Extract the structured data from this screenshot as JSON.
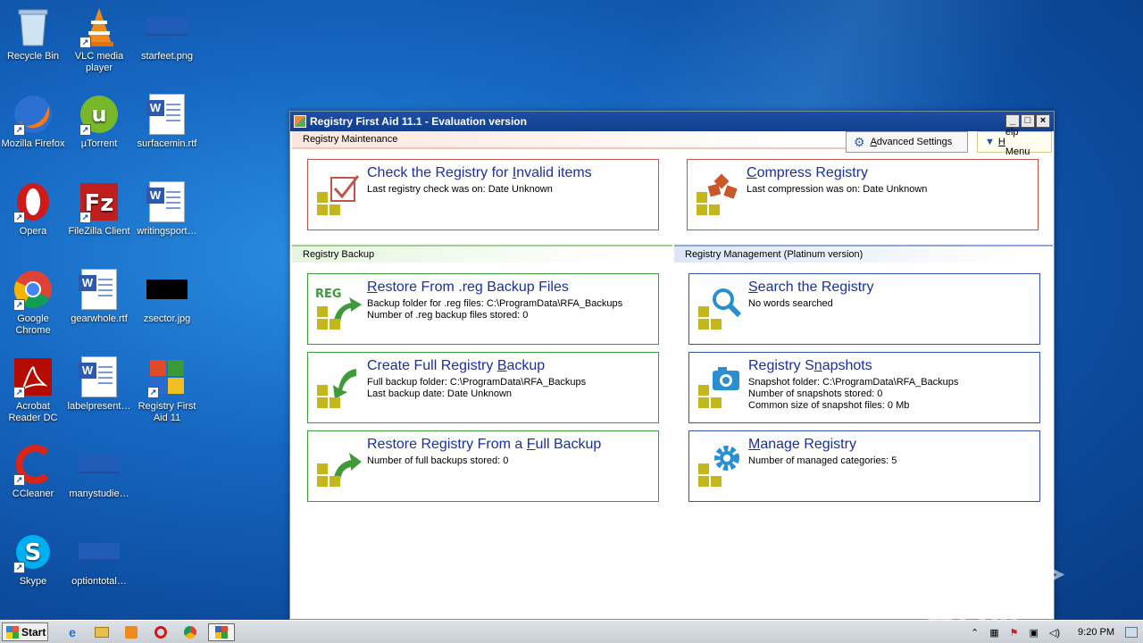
{
  "desktop": {
    "icons": [
      {
        "label": "Recycle Bin"
      },
      {
        "label": "VLC media player"
      },
      {
        "label": "starfeet.png"
      },
      {
        "label": "Mozilla Firefox"
      },
      {
        "label": "µTorrent"
      },
      {
        "label": "surfacemin.rtf"
      },
      {
        "label": "Opera"
      },
      {
        "label": "FileZilla Client"
      },
      {
        "label": "writingsport…"
      },
      {
        "label": "Google Chrome"
      },
      {
        "label": "gearwhole.rtf"
      },
      {
        "label": "zsector.jpg"
      },
      {
        "label": "Acrobat Reader DC"
      },
      {
        "label": "labelpresent…"
      },
      {
        "label": "Registry First Aid 11"
      },
      {
        "label": "CCleaner"
      },
      {
        "label": "manystudie…"
      },
      {
        "label": "Skype"
      },
      {
        "label": "optiontotal…"
      }
    ]
  },
  "window": {
    "title": "Registry First Aid 11.1 - Evaluation version",
    "controls": {
      "minimize": "_",
      "maximize": "□",
      "close": "×"
    }
  },
  "sections": {
    "maintenance": "Registry Maintenance",
    "backup": "Registry Backup",
    "management": "Registry Management (Platinum version)"
  },
  "toolbar": {
    "advanced_prefix": "A",
    "advanced_rest": "dvanced Settings",
    "help_prefix": "H",
    "help_rest": "elp Menu"
  },
  "cards": {
    "check": {
      "title_pre": "Check the Registry for ",
      "title_u": "I",
      "title_post": "nvalid items",
      "lines": [
        "Last registry check was on: Date Unknown"
      ]
    },
    "compress": {
      "title_pre": "",
      "title_u": "C",
      "title_post": "ompress Registry",
      "lines": [
        "Last compression was on: Date Unknown"
      ]
    },
    "restore_reg": {
      "title_pre": "",
      "title_u": "R",
      "title_post": "estore From .reg Backup Files",
      "lines": [
        "Backup folder for .reg files: C:\\ProgramData\\RFA_Backups",
        "Number of .reg backup files stored: 0"
      ]
    },
    "search": {
      "title_pre": "",
      "title_u": "S",
      "title_post": "earch the Registry",
      "lines": [
        "No words searched"
      ]
    },
    "full_backup": {
      "title_pre": "Create Full Registry ",
      "title_u": "B",
      "title_post": "ackup",
      "lines": [
        "Full backup folder: C:\\ProgramData\\RFA_Backups",
        "Last backup date: Date Unknown"
      ]
    },
    "snapshots": {
      "title_pre": "Registry S",
      "title_u": "n",
      "title_post": "apshots",
      "lines": [
        "Snapshot folder: C:\\ProgramData\\RFA_Backups",
        "Number of snapshots stored: 0",
        "Common size of snapshot files: 0 Mb"
      ]
    },
    "restore_full": {
      "title_pre": "Restore Registry From a ",
      "title_u": "F",
      "title_post": "ull Backup",
      "lines": [
        "Number of full backups stored: 0"
      ]
    },
    "manage": {
      "title_pre": "",
      "title_u": "M",
      "title_post": "anage Registry",
      "lines": [
        "Number of managed categories: 5"
      ]
    }
  },
  "icon_texts": {
    "reg": "REG"
  },
  "taskbar": {
    "start_label": "Start",
    "clock": "9:20 PM"
  },
  "watermark": "ANY ▷ RUN",
  "colors": {
    "title_link": "#1b2f9e",
    "maint_border": "#c0554a",
    "backup_border": "#3f9a3a",
    "manage_border": "#2e56a8",
    "block_yellow": "#c3b71b"
  }
}
